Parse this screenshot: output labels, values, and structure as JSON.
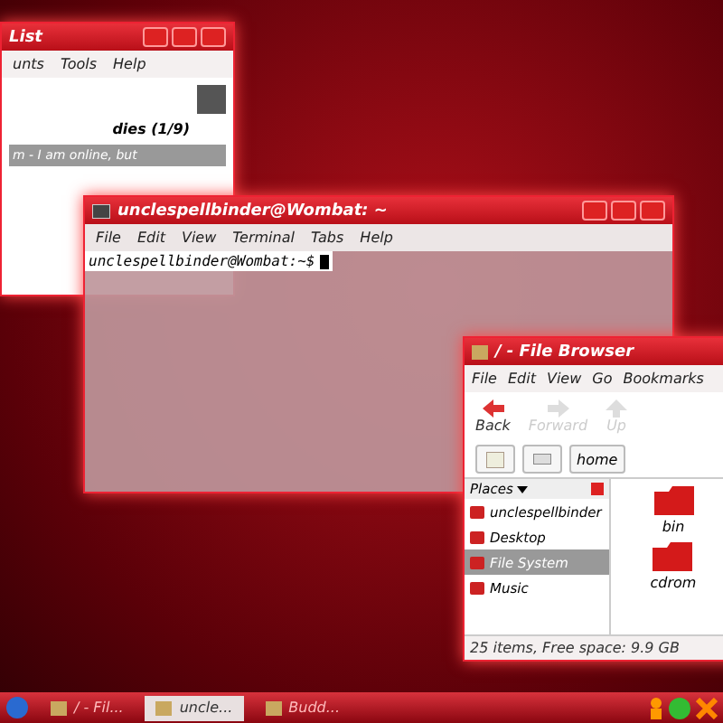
{
  "buddy_window": {
    "title": "List",
    "menu": [
      "unts",
      "Tools",
      "Help"
    ],
    "group": "dies (1/9)",
    "status": "m - I am online, but"
  },
  "terminal": {
    "title": "unclespellbinder@Wombat: ~",
    "menu": [
      "File",
      "Edit",
      "View",
      "Terminal",
      "Tabs",
      "Help"
    ],
    "prompt": "unclespellbinder@Wombat:~$"
  },
  "file_browser": {
    "title": "/ - File Browser",
    "menu": [
      "File",
      "Edit",
      "View",
      "Go",
      "Bookmarks"
    ],
    "toolbar": [
      {
        "label": "Back",
        "disabled": false
      },
      {
        "label": "Forward",
        "disabled": true
      },
      {
        "label": "Up",
        "disabled": true
      }
    ],
    "path": "home",
    "places_header": "Places",
    "places": [
      {
        "label": "unclespellbinder",
        "selected": false
      },
      {
        "label": "Desktop",
        "selected": false
      },
      {
        "label": "File System",
        "selected": true
      },
      {
        "label": "Music",
        "selected": false
      }
    ],
    "files": [
      "bin",
      "cdrom"
    ],
    "status": "25 items, Free space: 9.9 GB"
  },
  "taskbar": {
    "tasks": [
      {
        "label": "/ - Fil...",
        "selected": false
      },
      {
        "label": "uncle...",
        "selected": true
      },
      {
        "label": "Budd...",
        "selected": false
      }
    ]
  }
}
